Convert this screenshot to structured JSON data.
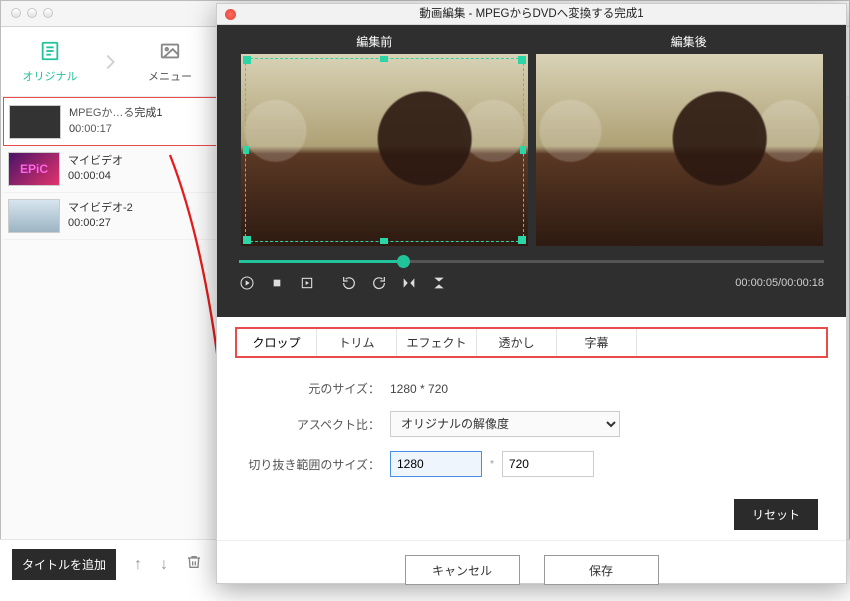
{
  "sidebar": {
    "tabs": {
      "original": "オリジナル",
      "menu": "メニュー"
    },
    "clips": [
      {
        "title": "MPEGか…る完成1",
        "duration": "00:00:17"
      },
      {
        "title": "マイビデオ",
        "duration": "00:00:04"
      },
      {
        "title": "マイビデオ-2",
        "duration": "00:00:27"
      }
    ],
    "add_title": "タイトルを追加"
  },
  "dialog": {
    "title": "動画編集 - MPEGからDVDへ変換する完成1",
    "preview": {
      "before": "編集前",
      "after": "編集後"
    },
    "time": {
      "current": "00:00:05",
      "total": "00:00:18"
    },
    "tabs": {
      "crop": "クロップ",
      "trim": "トリム",
      "effect": "エフェクト",
      "watermark": "透かし",
      "subtitle": "字幕"
    },
    "form": {
      "orig_size_label": "元のサイズ：",
      "orig_size": "1280 * 720",
      "aspect_label": "アスペクト比：",
      "aspect_value": "オリジナルの解像度",
      "crop_size_label": "切り抜き範囲のサイズ：",
      "crop_w": "1280",
      "crop_h": "720"
    },
    "buttons": {
      "reset": "リセット",
      "cancel": "キャンセル",
      "save": "保存"
    }
  }
}
